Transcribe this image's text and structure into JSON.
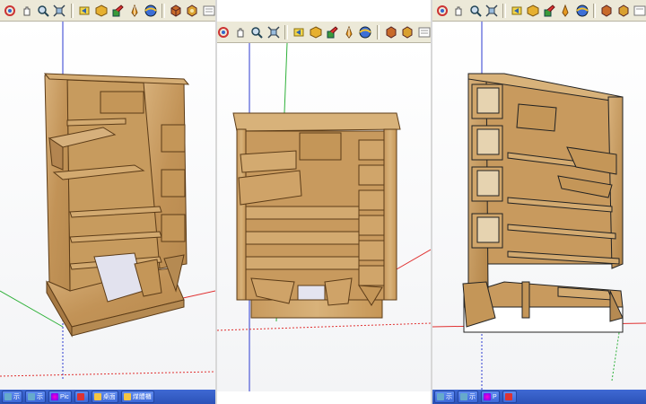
{
  "toolbar_icons": [
    "orbit-icon",
    "pan-icon",
    "zoom-icon",
    "zoom-extents-icon",
    "previous-view-icon",
    "component-icon",
    "paint-icon",
    "geo-location-icon",
    "3d-warehouse-icon",
    "share-model-icon",
    "extension-icon"
  ],
  "taskbar": {
    "left_items": [
      {
        "icon": "window-icon",
        "label": "示"
      },
      {
        "icon": "window-icon",
        "label": "示"
      },
      {
        "icon": "picasa-icon",
        "label": "Pic"
      },
      {
        "icon": "sketchup-icon",
        "label": ""
      },
      {
        "icon": "folder-icon",
        "label": "桌面"
      },
      {
        "icon": "folder-icon",
        "label": "煤體櫃"
      }
    ],
    "right_items": [
      {
        "icon": "window-icon",
        "label": "示"
      },
      {
        "icon": "window-icon",
        "label": "示"
      },
      {
        "icon": "picasa-icon",
        "label": "P"
      },
      {
        "icon": "sketchup-icon",
        "label": ""
      }
    ]
  },
  "colors": {
    "wood": "#c8a065",
    "wood_dark": "#8a6535",
    "axis_green": "#2fb13a",
    "axis_blue": "#2c3ad0",
    "axis_red": "#e03030"
  }
}
